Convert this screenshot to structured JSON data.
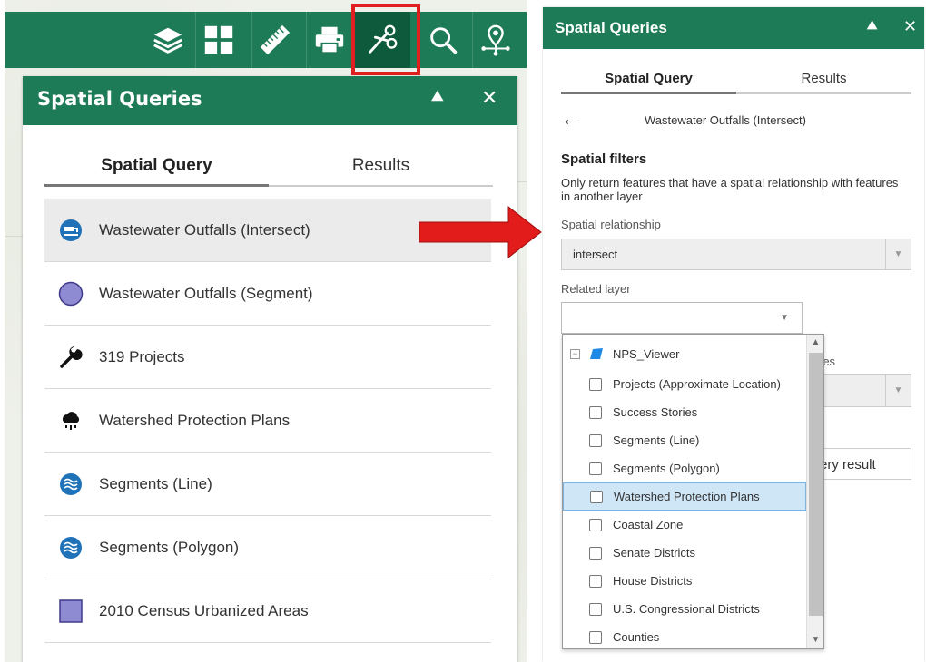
{
  "left": {
    "toolbar": {
      "tools": [
        {
          "icon": "layers-icon"
        },
        {
          "icon": "basemap-gallery-icon"
        },
        {
          "icon": "measure-ruler-icon"
        },
        {
          "icon": "print-icon"
        },
        {
          "icon": "spatial-query-scissors-icon"
        },
        {
          "icon": "search-icon"
        },
        {
          "icon": "location-pin-icon"
        }
      ]
    },
    "panel": {
      "title": "Spatial Queries",
      "tabs": [
        "Spatial Query",
        "Results"
      ],
      "queries": [
        {
          "label": "Wastewater Outfalls (Intersect)",
          "icon": "outfall-icon",
          "selected": true
        },
        {
          "label": "Wastewater Outfalls (Segment)",
          "icon": "purple-circle-icon"
        },
        {
          "label": "319 Projects",
          "icon": "wrench-icon"
        },
        {
          "label": "Watershed Protection Plans",
          "icon": "rain-cloud-icon"
        },
        {
          "label": "Segments (Line)",
          "icon": "water-waves-icon"
        },
        {
          "label": "Segments (Polygon)",
          "icon": "water-waves-icon"
        },
        {
          "label": "2010 Census Urbanized Areas",
          "icon": "purple-square-icon"
        }
      ]
    }
  },
  "right": {
    "title": "Spatial Queries",
    "tabs": [
      "Spatial Query",
      "Results"
    ],
    "query_name": "Wastewater Outfalls (Intersect)",
    "filters_title": "Spatial filters",
    "filters_desc": "Only return features that have a spatial relationship with features in another layer",
    "relationship_label": "Spatial relationship",
    "relationship_value": "intersect",
    "related_layer_label": "Related layer",
    "related_layer_value": "",
    "hidden_label_fragment": "res",
    "hidden_button_fragment": "ery result",
    "dropdown": {
      "group": "NPS_Viewer",
      "items": [
        "Projects (Approximate Location)",
        "Success Stories",
        "Segments (Line)",
        "Segments (Polygon)",
        "Watershed Protection Plans",
        "Coastal Zone",
        "Senate Districts",
        "House Districts",
        "U.S. Congressional Districts",
        "Counties"
      ],
      "selected": "Watershed Protection Plans"
    }
  },
  "colors": {
    "header_green": "#1e7b58",
    "highlight_red": "#e02020",
    "arrow_red": "#e21b1b",
    "icon_blue": "#2072b8",
    "icon_purple": "#8f8bd2"
  }
}
